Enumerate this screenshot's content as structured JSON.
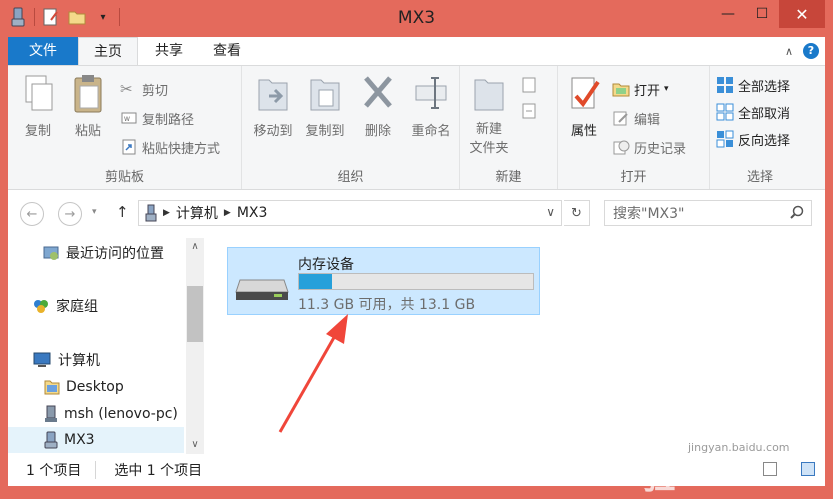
{
  "window": {
    "title": "MX3"
  },
  "titlebar": {
    "minimize": "—",
    "maximize": "☐",
    "close": "✕"
  },
  "tabs": {
    "file": "文件",
    "home": "主页",
    "share": "共享",
    "view": "查看"
  },
  "ribbon": {
    "clipboard": {
      "copy": "复制",
      "paste": "粘贴",
      "cut": "剪切",
      "copy_path": "复制路径",
      "paste_shortcut": "粘贴快捷方式",
      "label": "剪贴板"
    },
    "organize": {
      "move_to": "移动到",
      "copy_to": "复制到",
      "delete": "删除",
      "rename": "重命名",
      "label": "组织"
    },
    "new": {
      "new_folder": "新建\n文件夹",
      "label": "新建"
    },
    "open": {
      "properties": "属性",
      "open": "打开",
      "edit": "编辑",
      "history": "历史记录",
      "label": "打开"
    },
    "select": {
      "select_all": "全部选择",
      "select_none": "全部取消",
      "invert": "反向选择",
      "label": "选择"
    }
  },
  "address": {
    "crumbs": [
      "计算机",
      "MX3"
    ],
    "search_placeholder": "搜索\"MX3\""
  },
  "nav": {
    "items": [
      {
        "label": "最近访问的位置"
      },
      {
        "label": "家庭组"
      },
      {
        "label": "计算机"
      },
      {
        "label": "Desktop"
      },
      {
        "label": "msh (lenovo-pc)"
      },
      {
        "label": "MX3"
      }
    ]
  },
  "drive": {
    "name": "内存设备",
    "used_fraction": 0.14,
    "space_text": "11.3 GB 可用，共 13.1 GB"
  },
  "status": {
    "count": "1 个项目",
    "selected": "选中 1 个项目"
  },
  "watermark": {
    "brand": "Baidu 经验",
    "url": "jingyan.baidu.com"
  },
  "colors": {
    "titlebar": "#e46a5c",
    "file_tab": "#1979ca",
    "tile": "#cce8ff",
    "bar_fill": "#26a0da",
    "arrow": "#f0463a"
  }
}
